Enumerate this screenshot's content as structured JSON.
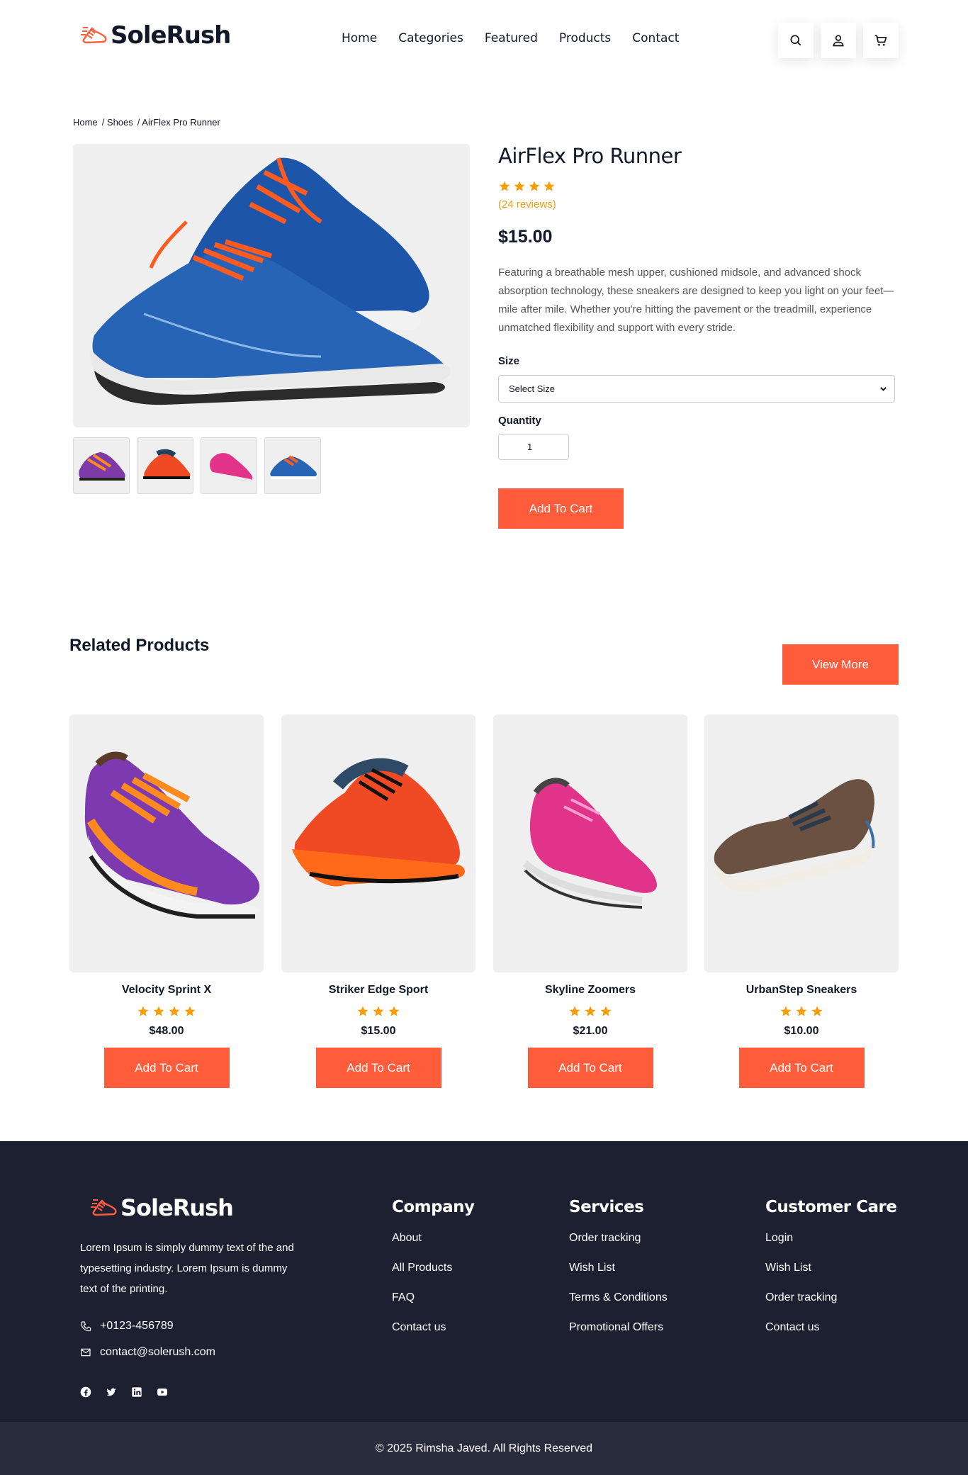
{
  "brand": {
    "name": "SoleRush",
    "accent": "#ff5c3c",
    "star_color": "#f59e0b",
    "footer_bg": "#1c2031"
  },
  "nav": {
    "items": [
      "Home",
      "Categories",
      "Featured",
      "Products",
      "Contact"
    ]
  },
  "header_icons": [
    "search-icon",
    "user-icon",
    "cart-icon"
  ],
  "breadcrumb": {
    "items": [
      "Home",
      "/ Shoes",
      "/ AirFlex Pro Runner"
    ]
  },
  "product": {
    "title": "AirFlex Pro Runner",
    "rating": 4,
    "reviews": "(24 reviews)",
    "price": "$15.00",
    "description": "Featuring a breathable mesh upper, cushioned midsole, and advanced shock absorption technology, these sneakers are designed to keep you light on your feet—mile after mile. Whether you're hitting the pavement or the treadmill, experience unmatched flexibility and support with every stride.",
    "size_label": "Size",
    "size_selected": "Select Size",
    "quantity_label": "Quantity",
    "quantity_value": "1",
    "add_to_cart": "Add To Cart"
  },
  "related": {
    "title": "Related Products",
    "view_more": "View More",
    "items": [
      {
        "name": "Velocity Sprint X",
        "rating": 4,
        "price": "$48.00",
        "button": "Add To Cart"
      },
      {
        "name": "Striker Edge Sport",
        "rating": 3,
        "price": "$15.00",
        "button": "Add To Cart"
      },
      {
        "name": "Skyline Zoomers",
        "rating": 3,
        "price": "$21.00",
        "button": "Add To Cart"
      },
      {
        "name": "UrbanStep Sneakers",
        "rating": 3,
        "price": "$10.00",
        "button": "Add To Cart"
      }
    ]
  },
  "footer": {
    "about": "Lorem Ipsum is simply dummy text of the and typesetting industry. Lorem Ipsum is dummy text of the printing.",
    "phone": "+0123-456789",
    "email": "contact@solerush.com",
    "socials": [
      "facebook-icon",
      "twitter-icon",
      "linkedin-icon",
      "youtube-icon"
    ],
    "columns": [
      {
        "title": "Company",
        "links": [
          "About",
          "All Products",
          "FAQ",
          "Contact us"
        ]
      },
      {
        "title": "Services",
        "links": [
          "Order tracking",
          "Wish List",
          "Terms & Conditions",
          "Promotional Offers"
        ]
      },
      {
        "title": "Customer Care",
        "links": [
          "Login",
          "Wish List",
          "Order tracking",
          "Contact us"
        ]
      }
    ],
    "copyright": "© 2025 Rimsha Javed. All Rights Reserved"
  }
}
